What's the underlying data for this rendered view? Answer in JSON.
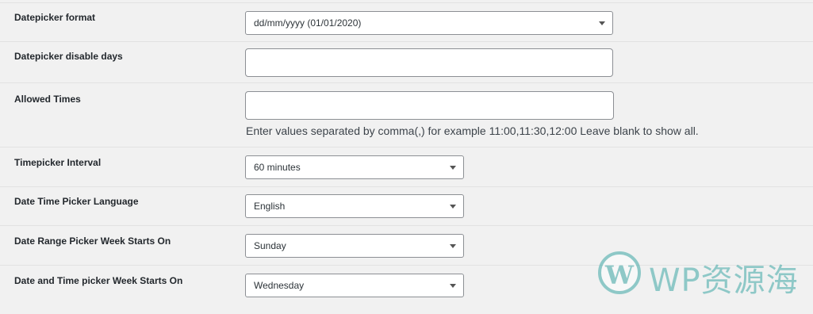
{
  "fields": [
    {
      "label": "Datepicker format",
      "type": "select",
      "value": "dd/mm/yyyy (01/01/2020)"
    },
    {
      "label": "Datepicker disable days",
      "type": "text",
      "value": ""
    },
    {
      "label": "Allowed Times",
      "type": "text",
      "value": "",
      "description": "Enter values separated by comma(,) for example 11:00,11:30,12:00 Leave blank to show all."
    },
    {
      "label": "Timepicker Interval",
      "type": "select",
      "value": "60 minutes"
    },
    {
      "label": "Date Time Picker Language",
      "type": "select",
      "value": "English"
    },
    {
      "label": "Date Range Picker Week Starts On",
      "type": "select",
      "value": "Sunday"
    },
    {
      "label": "Date and Time picker Week Starts On",
      "type": "select",
      "value": "Wednesday"
    }
  ],
  "watermark": {
    "logo_letter": "W",
    "text": "WP资源海"
  },
  "colors": {
    "watermark": "#3fa7a5",
    "background": "#f1f1f1"
  }
}
